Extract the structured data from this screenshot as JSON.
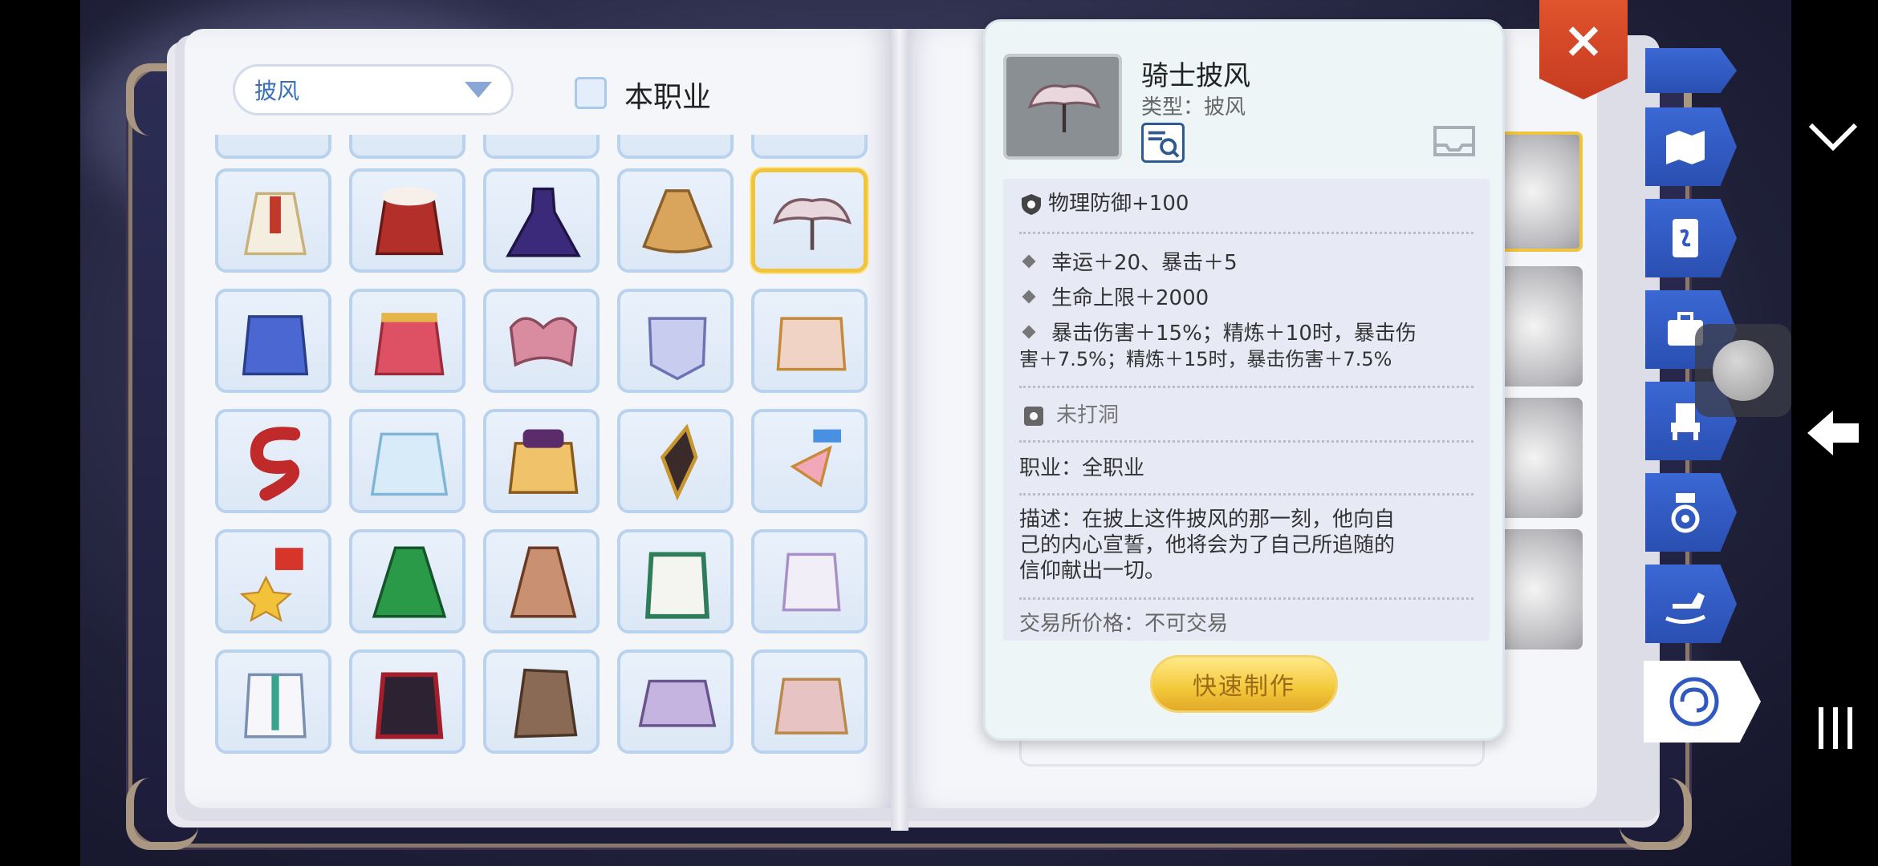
{
  "filter": {
    "dropdown_value": "披风",
    "checkbox_label": "本职业"
  },
  "item": {
    "name": "骑士披风",
    "type": "类型：披风",
    "stats": {
      "main": "物理防御+100",
      "lines": [
        "幸运＋20、暴击＋5",
        "生命上限＋2000"
      ],
      "crit_line_1": "暴击伤害＋15%；精炼＋10时，暴击伤",
      "crit_line_2": "害＋7.5%；精炼＋15时，暴击伤害＋7.5%",
      "socket": "未打洞",
      "job": "职业：全职业",
      "desc_1": "描述：在披上这件披风的那一刻，他向自",
      "desc_2": "己的内心宣誓，他将会为了自己所追随的",
      "desc_3": "信仰献出一切。",
      "trade": "交易所价格：不可交易"
    },
    "craft_label": "快速制作"
  },
  "close_label": "×",
  "grid_icons": [
    [
      "white-robe-cape",
      "red-white-fur-cape",
      "purple-dress-cape",
      "tan-cloak",
      "knight-cape"
    ],
    [
      "blue-torn-cape",
      "red-gold-cape",
      "pink-ribbon-cape",
      "silver-armor-cape",
      "gold-feather-cape"
    ],
    [
      "red-scarf",
      "ice-wing-cape",
      "gold-fringe-cape",
      "dark-horn-charm",
      "rainbow-wing-charm"
    ],
    [
      "star-medal",
      "green-hood-cape",
      "brown-hood-cape",
      "green-white-coat",
      "white-shirt"
    ],
    [
      "white-jacket",
      "dark-red-coat",
      "brown-leather-cape",
      "lavender-cape",
      "pink-gold-cape"
    ]
  ],
  "colors": {
    "accent": "#3a6fb8",
    "selected_border": "#f0c43c",
    "close": "#d0462a",
    "tab": "#2f58c0"
  },
  "side_tabs": [
    "map-icon",
    "card-icon",
    "briefcase-icon",
    "throne-icon",
    "medal-icon",
    "rocking-horse-icon",
    "swirl-icon"
  ]
}
